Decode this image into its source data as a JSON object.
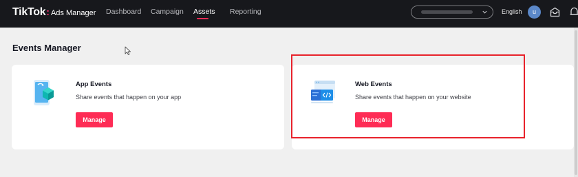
{
  "brand": {
    "name": "TikTok",
    "separator": ":",
    "product": "Ads Manager"
  },
  "nav": {
    "items": [
      {
        "label": "Dashboard",
        "active": false
      },
      {
        "label": "Campaign",
        "active": false
      },
      {
        "label": "Assets",
        "active": true
      },
      {
        "label": "Reporting",
        "active": false
      }
    ]
  },
  "header": {
    "account_selector": {
      "icon": "chevron-down-icon"
    },
    "language": "English",
    "avatar_initial": "u",
    "icons": [
      "inbox-icon",
      "bell-icon"
    ]
  },
  "page": {
    "title": "Events Manager"
  },
  "cards": [
    {
      "title": "App Events",
      "description": "Share events that happen on your app",
      "button": "Manage",
      "icon": "app-events-icon"
    },
    {
      "title": "Web Events",
      "description": "Share events that happen on your website",
      "button": "Manage",
      "icon": "web-events-icon"
    }
  ],
  "colors": {
    "topbar": "#17181c",
    "accent": "#fe2c55",
    "background": "#f0f0f0",
    "highlight_border": "#e8222b"
  }
}
